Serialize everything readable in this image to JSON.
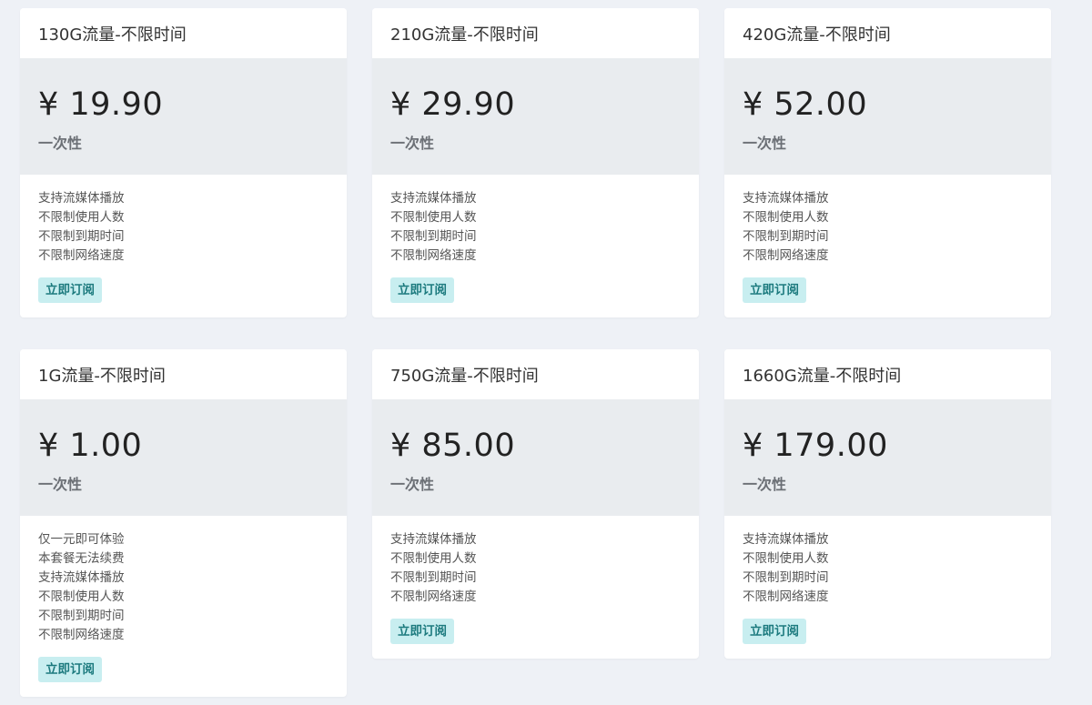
{
  "plans": [
    {
      "title": "130G流量-不限时间",
      "price": "¥ 19.90",
      "period": "一次性",
      "features": [
        "支持流媒体播放",
        "不限制使用人数",
        "不限制到期时间",
        "不限制网络速度"
      ],
      "button": "立即订阅"
    },
    {
      "title": "210G流量-不限时间",
      "price": "¥ 29.90",
      "period": "一次性",
      "features": [
        "支持流媒体播放",
        "不限制使用人数",
        "不限制到期时间",
        "不限制网络速度"
      ],
      "button": "立即订阅"
    },
    {
      "title": "420G流量-不限时间",
      "price": "¥ 52.00",
      "period": "一次性",
      "features": [
        "支持流媒体播放",
        "不限制使用人数",
        "不限制到期时间",
        "不限制网络速度"
      ],
      "button": "立即订阅"
    },
    {
      "title": "1G流量-不限时间",
      "price": "¥ 1.00",
      "period": "一次性",
      "features": [
        "仅一元即可体验",
        "本套餐无法续费",
        "支持流媒体播放",
        "不限制使用人数",
        "不限制到期时间",
        "不限制网络速度"
      ],
      "button": "立即订阅"
    },
    {
      "title": "750G流量-不限时间",
      "price": "¥ 85.00",
      "period": "一次性",
      "features": [
        "支持流媒体播放",
        "不限制使用人数",
        "不限制到期时间",
        "不限制网络速度"
      ],
      "button": "立即订阅"
    },
    {
      "title": "1660G流量-不限时间",
      "price": "¥ 179.00",
      "period": "一次性",
      "features": [
        "支持流媒体播放",
        "不限制使用人数",
        "不限制到期时间",
        "不限制网络速度"
      ],
      "button": "立即订阅"
    }
  ],
  "colors": {
    "page_background": "#eef1f6",
    "price_background": "#e9ecef",
    "button_background": "#c8eef0",
    "button_text": "#1c7a7e"
  }
}
